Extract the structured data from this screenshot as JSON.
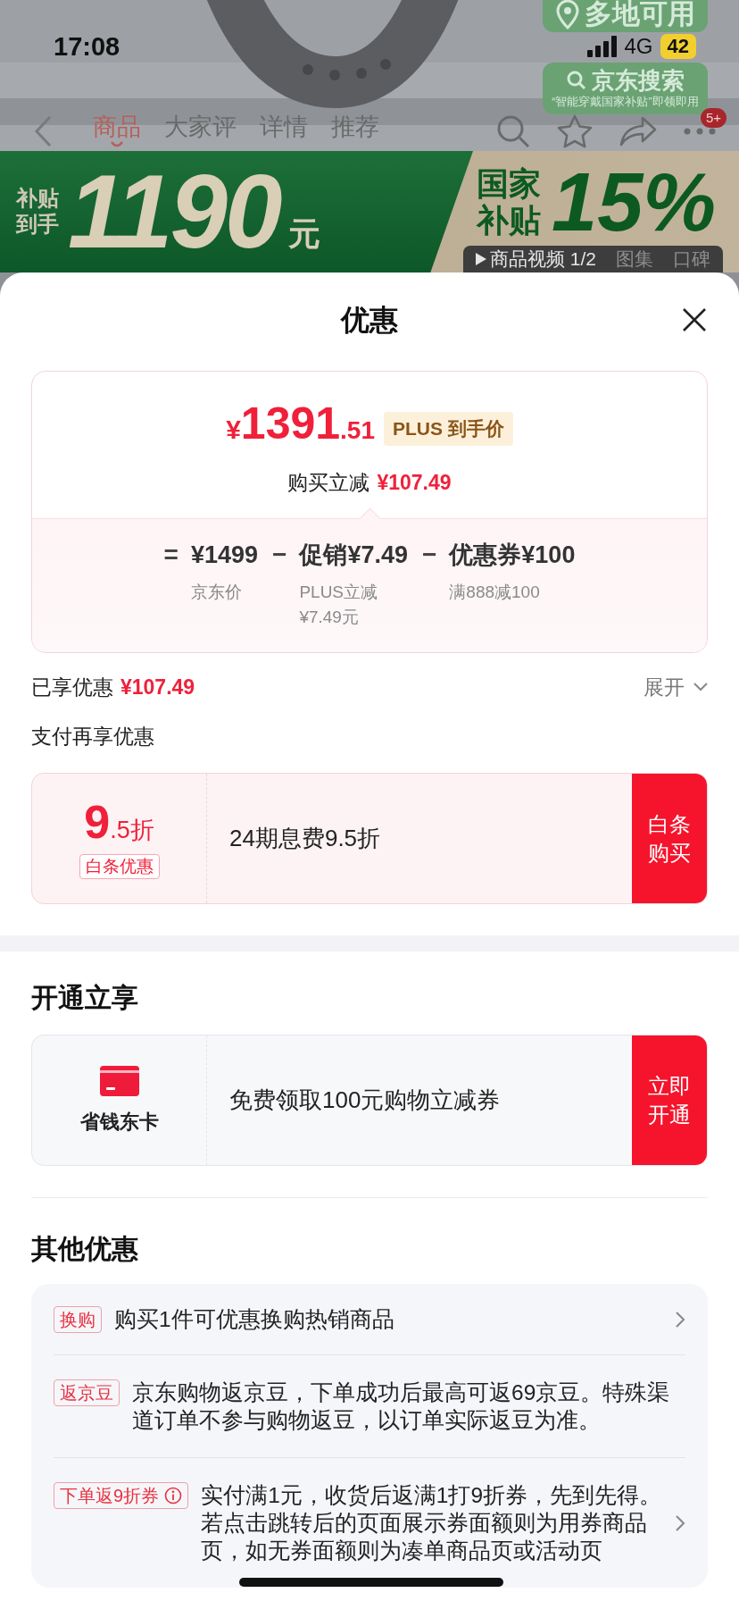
{
  "status_bar": {
    "time": "17:08",
    "network": "4G",
    "battery": "42"
  },
  "product_page": {
    "tags": [
      {
        "kind": "location",
        "label": "多地可用"
      },
      {
        "kind": "search",
        "label": "京东搜索",
        "caption": "“智能穿戴国家补贴”即领即用"
      }
    ],
    "tabs": [
      {
        "label": "商品",
        "selected": true
      },
      {
        "label": "大家评",
        "selected": false
      },
      {
        "label": "详情",
        "selected": false
      },
      {
        "label": "推荐",
        "selected": false
      }
    ],
    "more_badge": "5+",
    "banner": {
      "subsidy_label": "补贴到手",
      "price": "1190",
      "unit": "元",
      "national_label": "国家补贴",
      "percent": "15%"
    },
    "media_tabs": [
      {
        "label": "商品视频 1/2",
        "selected": true
      },
      {
        "label": "图集",
        "selected": false
      },
      {
        "label": "口碑",
        "selected": false
      }
    ]
  },
  "sheet": {
    "title": "优惠",
    "price_card": {
      "currency": "¥",
      "integer": "1391",
      "decimal": ".51",
      "badge": "PLUS 到手价",
      "reduction_label": "购买立减",
      "reduction": "¥107.49",
      "breakdown": [
        {
          "operator": "=",
          "amount": "¥1499",
          "note": "京东价"
        },
        {
          "operator": "−",
          "amount": "促销¥7.49",
          "note": "PLUS立减¥7.49元"
        },
        {
          "operator": "−",
          "amount": "优惠券¥100",
          "note": "满888减100"
        }
      ]
    },
    "savings": {
      "label": "已享优惠",
      "amount": "¥107.49",
      "toggle": "展开"
    },
    "payment_section": {
      "title": "支付再享优惠",
      "card": {
        "kind": "rate",
        "rate_whole": "9",
        "rate_fraction": ".5折",
        "tag": "白条优惠",
        "description": "24期息费9.5折",
        "action": "白条购买"
      }
    },
    "membership_section": {
      "title": "开通立享",
      "card": {
        "kind": "membership",
        "name": "省钱东卡",
        "description": "免费领取100元购物立减券",
        "action": "立即开通"
      }
    },
    "other_section": {
      "title": "其他优惠",
      "items": [
        {
          "tag": "换购",
          "text": "购买1件可优惠换购热销商品",
          "info_icon": false,
          "arrow": true
        },
        {
          "tag": "返京豆",
          "text": "京东购物返京豆，下单成功后最高可返69京豆。特殊渠道订单不参与购物返豆，以订单实际返豆为准。",
          "info_icon": false,
          "arrow": false
        },
        {
          "tag": "下单返9折券",
          "text": "实付满1元，收货后返满1打9折券，先到先得。若点击跳转后的页面展示券面额则为用券商品页，如无券面额则为凑单商品页或活动页",
          "info_icon": true,
          "arrow": true
        }
      ]
    }
  }
}
